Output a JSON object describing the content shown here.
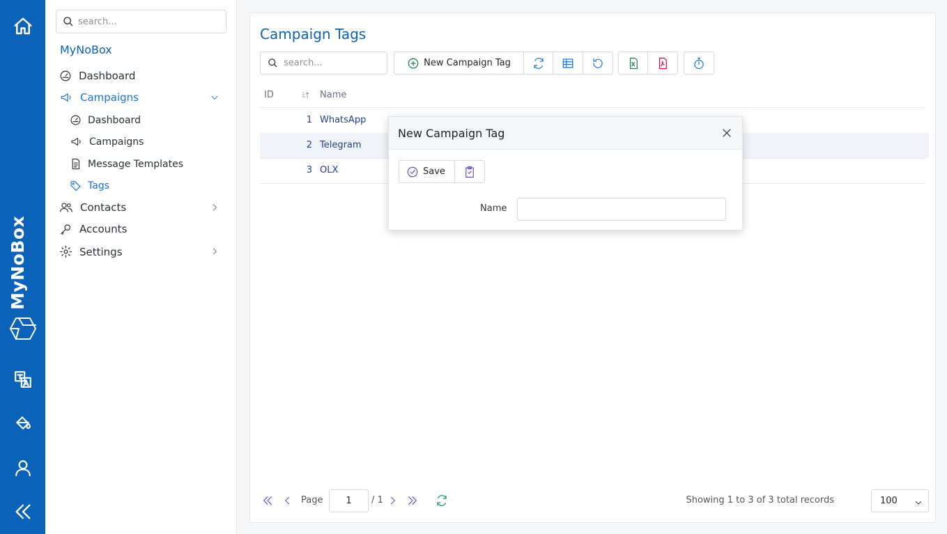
{
  "rail": {
    "brand": "MyNoBox",
    "icons": [
      "home-icon",
      "box-logo-icon",
      "translate-icon",
      "paint-bucket-icon",
      "user-icon",
      "collapse-icon"
    ]
  },
  "sidebar": {
    "search_placeholder": "search...",
    "brand": "MyNoBox",
    "items": [
      {
        "label": "Dashboard"
      },
      {
        "label": "Campaigns"
      },
      {
        "label": "Dashboard"
      },
      {
        "label": "Campaigns"
      },
      {
        "label": "Message Templates"
      },
      {
        "label": "Tags"
      },
      {
        "label": "Contacts"
      },
      {
        "label": "Accounts"
      },
      {
        "label": "Settings"
      }
    ]
  },
  "main": {
    "title": "Campaign Tags",
    "search_placeholder": "search...",
    "new_button": "New Campaign Tag",
    "columns": [
      "ID",
      "Name"
    ],
    "rows": [
      {
        "id": "1",
        "name": "WhatsApp"
      },
      {
        "id": "2",
        "name": "Telegram"
      },
      {
        "id": "3",
        "name": "OLX"
      }
    ],
    "pager": {
      "page_label": "Page",
      "page": "1",
      "total": "/ 1",
      "records": "Showing 1 to 3 of 3 total records",
      "page_size": "100"
    }
  },
  "modal": {
    "title": "New Campaign Tag",
    "save": "Save",
    "name_label": "Name",
    "name_value": ""
  },
  "colors": {
    "accent": "#0a63b8",
    "link": "#1a73d9",
    "excel": "#1e7e45",
    "pdf": "#c8102e"
  }
}
